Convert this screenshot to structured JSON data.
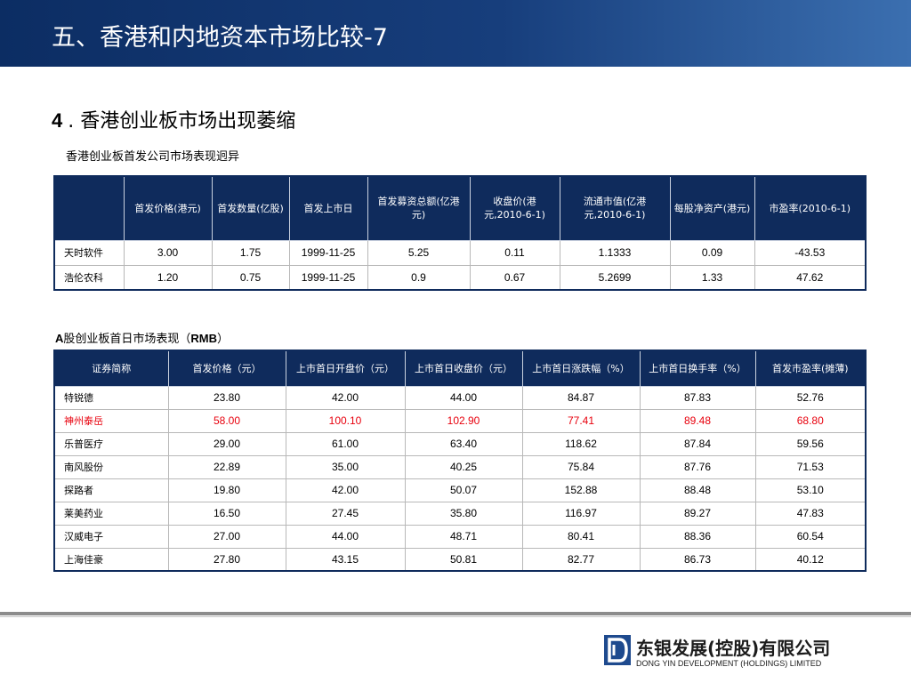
{
  "header": {
    "title": "五、香港和内地资本市场比较-7"
  },
  "section": {
    "number": "4",
    "title": "香港创业板市场出现萎缩"
  },
  "table1": {
    "caption": "香港创业板首发公司市场表现迥异",
    "headers": [
      "",
      "首发价格(港元)",
      "首发数量(亿股)",
      "首发上市日",
      "首发募资总额(亿港元)",
      "收盘价(港元,2010-6-1)",
      "流通市值(亿港元,2010-6-1)",
      "每股净资产(港元)",
      "市盈率(2010-6-1)"
    ],
    "rows": [
      [
        "天时软件",
        "3.00",
        "1.75",
        "1999-11-25",
        "5.25",
        "0.11",
        "1.1333",
        "0.09",
        "-43.53"
      ],
      [
        "浩伦农科",
        "1.20",
        "0.75",
        "1999-11-25",
        "0.9",
        "0.67",
        "5.2699",
        "1.33",
        "47.62"
      ]
    ]
  },
  "table2": {
    "caption_prefix": "A",
    "caption_middle": "股创业板首日市场表现（",
    "caption_bold": "RMB",
    "caption_suffix": "）",
    "headers": [
      "证券简称",
      "首发价格（元）",
      "上市首日开盘价（元）",
      "上市首日收盘价（元）",
      "上市首日涨跌幅（%）",
      "上市首日换手率（%）",
      "首发市盈率(摊薄)"
    ],
    "rows": [
      [
        "特锐德",
        "23.80",
        "42.00",
        "44.00",
        "84.87",
        "87.83",
        "52.76"
      ],
      [
        "神州泰岳",
        "58.00",
        "100.10",
        "102.90",
        "77.41",
        "89.48",
        "68.80"
      ],
      [
        "乐普医疗",
        "29.00",
        "61.00",
        "63.40",
        "118.62",
        "87.84",
        "59.56"
      ],
      [
        "南风股份",
        "22.89",
        "35.00",
        "40.25",
        "75.84",
        "87.76",
        "71.53"
      ],
      [
        "探路者",
        "19.80",
        "42.00",
        "50.07",
        "152.88",
        "88.48",
        "53.10"
      ],
      [
        "莱美药业",
        "16.50",
        "27.45",
        "35.80",
        "116.97",
        "89.27",
        "47.83"
      ],
      [
        "汉威电子",
        "27.00",
        "44.00",
        "48.71",
        "80.41",
        "88.36",
        "60.54"
      ],
      [
        "上海佳豪",
        "27.80",
        "43.15",
        "50.81",
        "82.77",
        "86.73",
        "40.12"
      ]
    ],
    "highlight_color": "#e8000d"
  },
  "footer": {
    "company_cn": "东银发展(控股)有限公司",
    "company_en": "DONG YIN DEVELOPMENT (HOLDINGS) LIMITED",
    "logo_icon": "dongyin-logo-icon"
  },
  "colors": {
    "header_bg": "#0f2b5c",
    "accent_red": "#e8000d"
  }
}
